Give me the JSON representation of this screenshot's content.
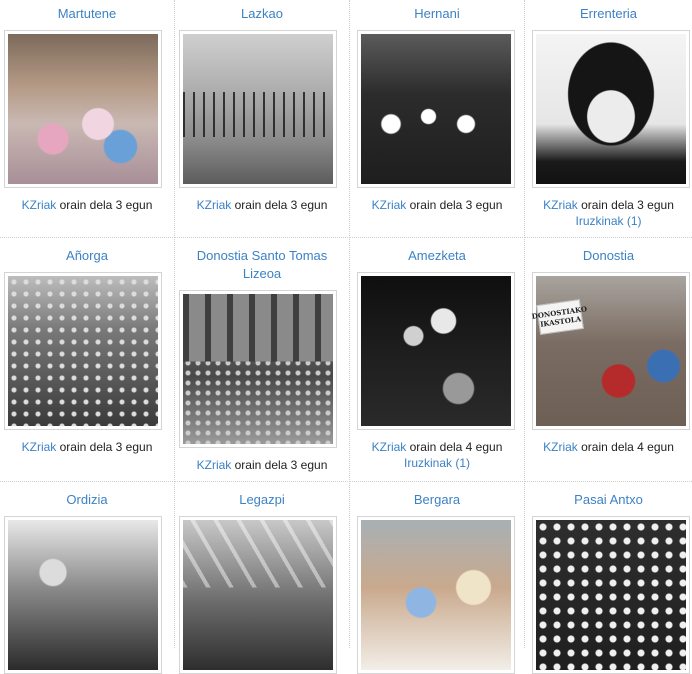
{
  "items": [
    {
      "title": "Martutene",
      "author": "KZriak",
      "ago": "orain dela 3 egun",
      "comments": ""
    },
    {
      "title": "Lazkao",
      "author": "KZriak",
      "ago": "orain dela 3 egun",
      "comments": ""
    },
    {
      "title": "Hernani",
      "author": "KZriak",
      "ago": "orain dela 3 egun",
      "comments": ""
    },
    {
      "title": "Errenteria",
      "author": "KZriak",
      "ago": "orain dela 3 egun",
      "comments": "Iruzkinak (1)"
    },
    {
      "title": "Añorga",
      "author": "KZriak",
      "ago": "orain dela 3 egun",
      "comments": ""
    },
    {
      "title": "Donostia Santo Tomas Lizeoa",
      "author": "KZriak",
      "ago": "orain dela 3 egun",
      "comments": ""
    },
    {
      "title": "Amezketa",
      "author": "KZriak",
      "ago": "orain dela 4 egun",
      "comments": "Iruzkinak (1)"
    },
    {
      "title": "Donostia",
      "author": "KZriak",
      "ago": "orain dela 4 egun",
      "comments": ""
    },
    {
      "title": "Ordizia",
      "author": "",
      "ago": "",
      "comments": ""
    },
    {
      "title": "Legazpi",
      "author": "",
      "ago": "",
      "comments": ""
    },
    {
      "title": "Bergara",
      "author": "",
      "ago": "",
      "comments": ""
    },
    {
      "title": "Pasai Antxo",
      "author": "",
      "ago": "",
      "comments": ""
    }
  ],
  "photo_signs": {
    "donostia_sign": "DONOSTIAKO IKASTOLA"
  }
}
